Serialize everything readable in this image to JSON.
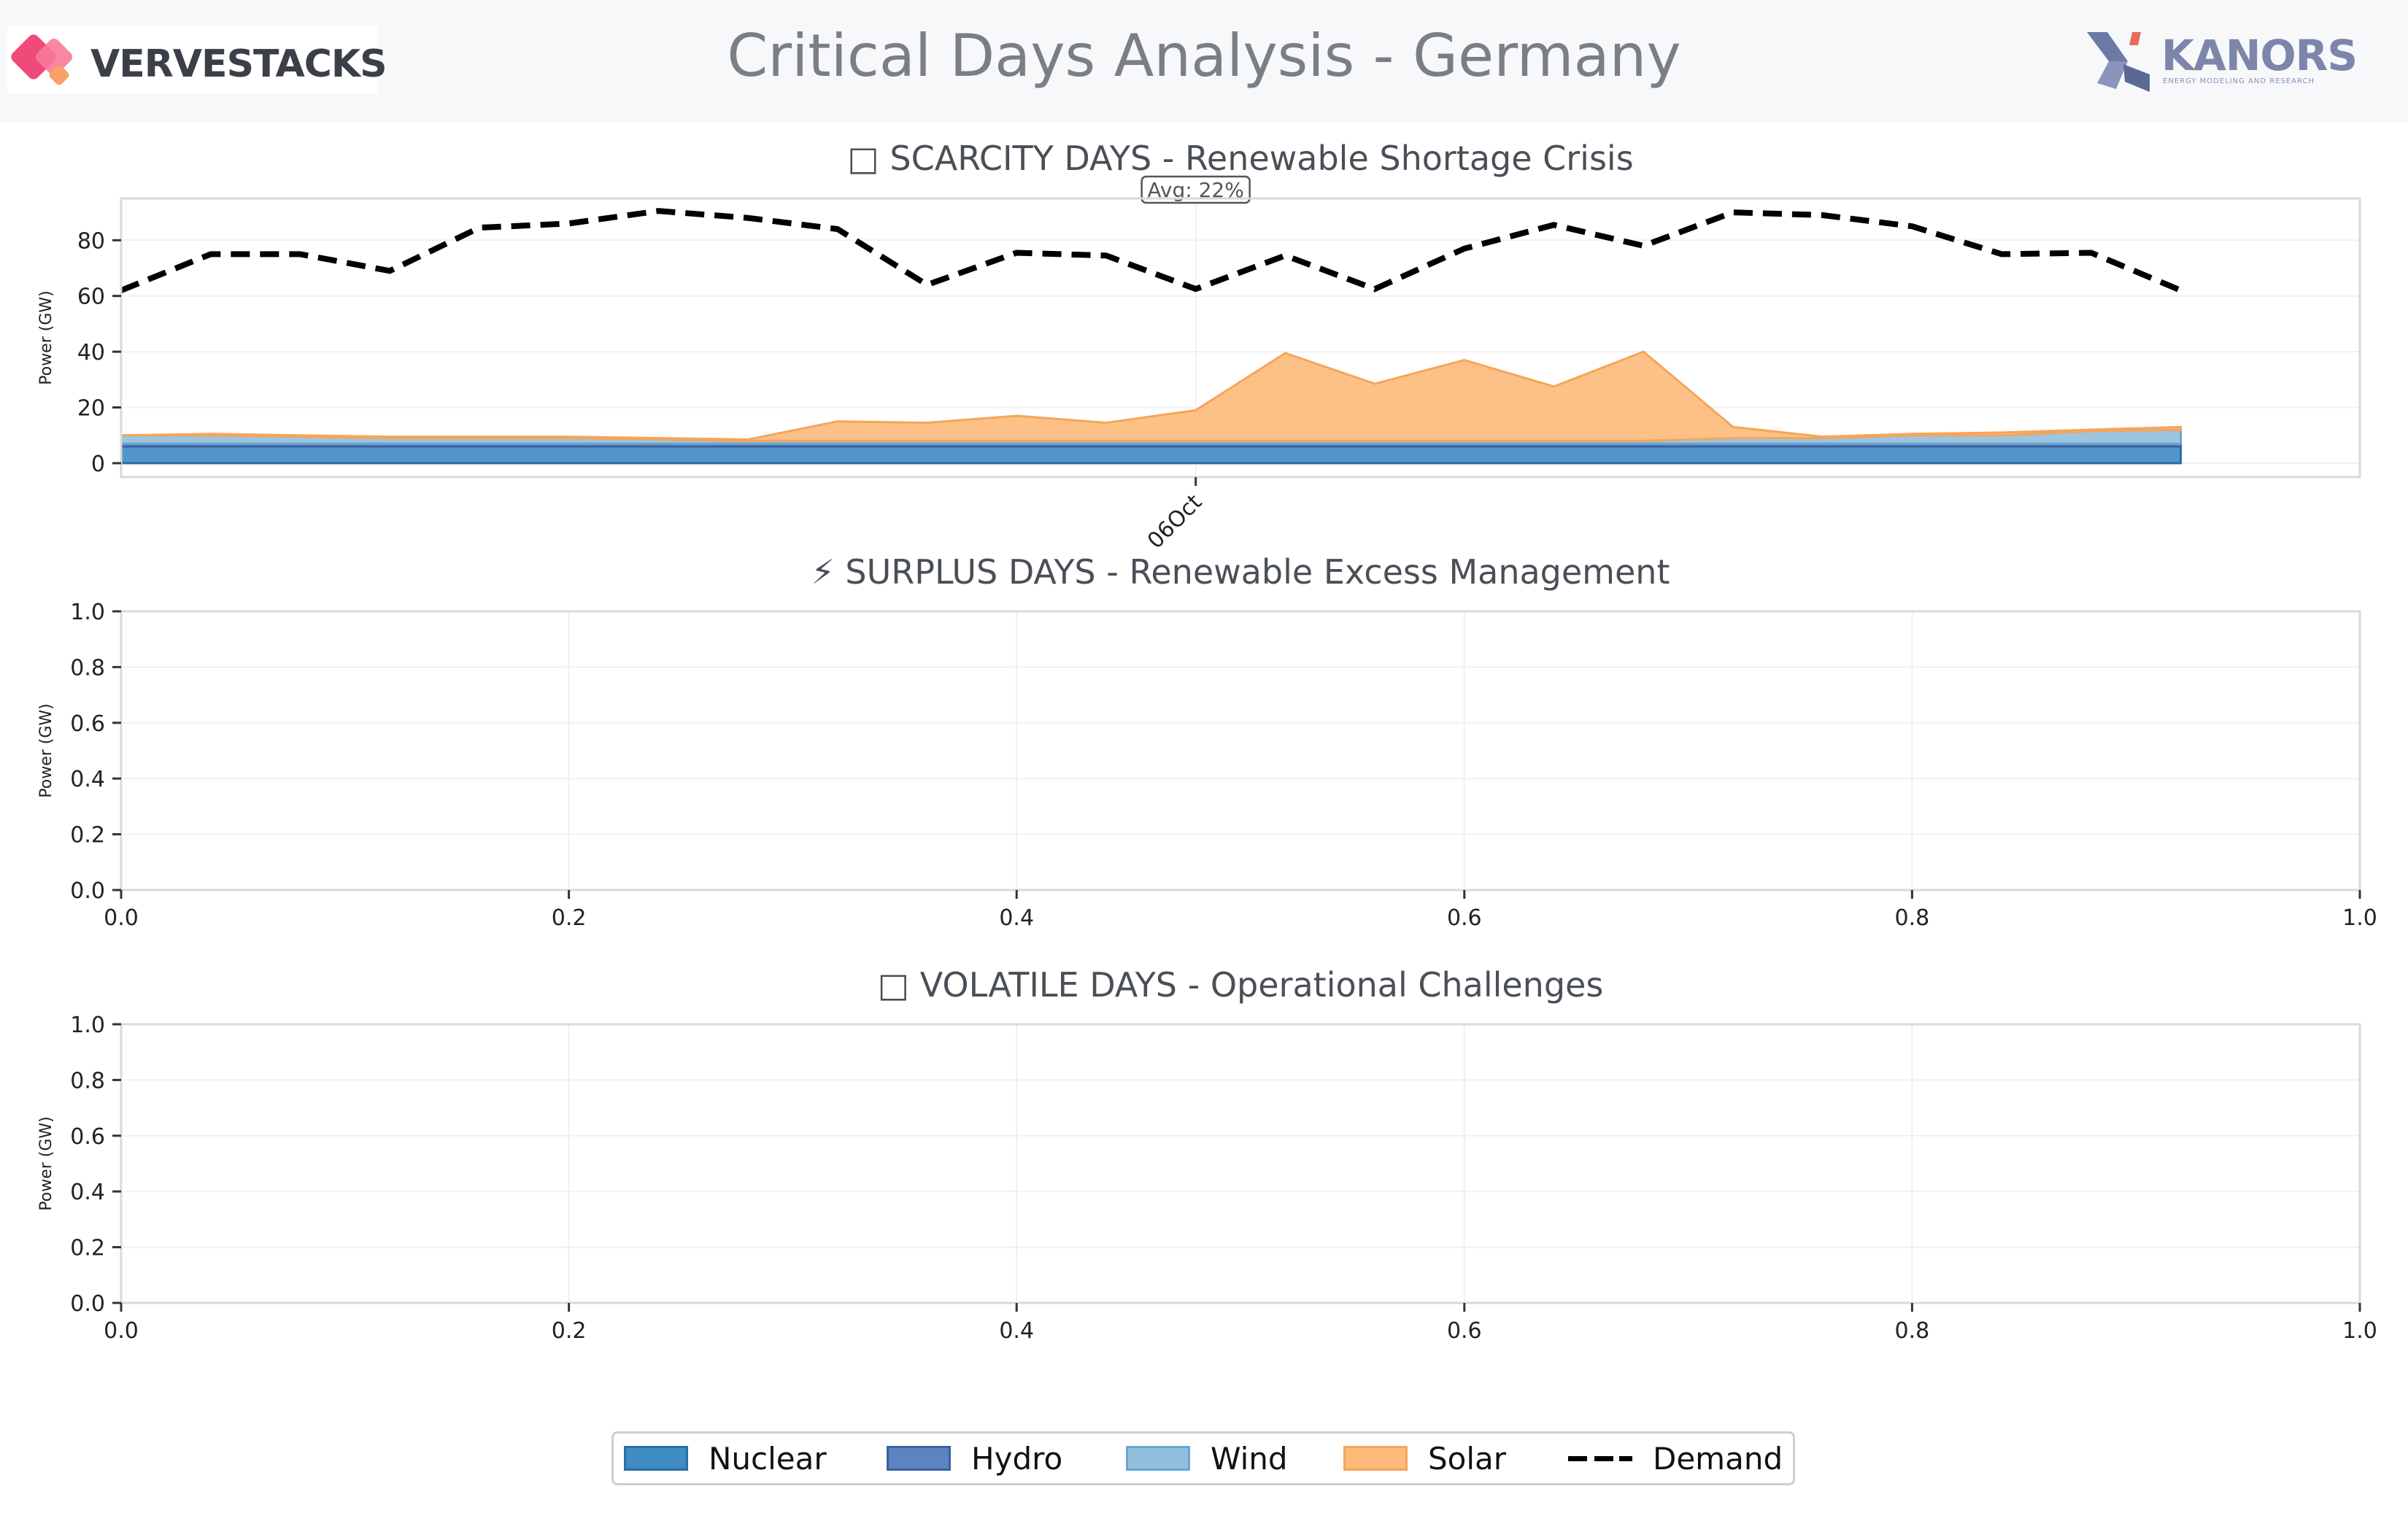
{
  "header": {
    "title": "Critical Days Analysis - Germany",
    "left_logo_text": "VERVESTACKS",
    "right_logo_text": "KANORS",
    "right_logo_subtitle": "ENERGY MODELING AND RESEARCH"
  },
  "colors": {
    "nuclear": "#1f77b4",
    "hydro": "#2c5aa0",
    "wind": "#6baed6",
    "solar": "#fd8d3c",
    "demand": "#000000",
    "grid": "#eeeeee",
    "axis": "#cccccc"
  },
  "legend": [
    {
      "name": "Nuclear",
      "kind": "area",
      "color": "#3f8bc4",
      "edge": "#2a6ea6"
    },
    {
      "name": "Hydro",
      "kind": "area",
      "color": "#5b84c0",
      "edge": "#3a62a0"
    },
    {
      "name": "Wind",
      "kind": "area",
      "color": "#92bfdd",
      "edge": "#6aa6cf"
    },
    {
      "name": "Solar",
      "kind": "area",
      "color": "#fdba7a",
      "edge": "#f5a55a"
    },
    {
      "name": "Demand",
      "kind": "dashed-line",
      "color": "#000000"
    }
  ],
  "chart_data": [
    {
      "type": "area",
      "title": "□ SCARCITY DAYS - Renewable Shortage Crisis",
      "ylabel": "Power (GW)",
      "ylim": [
        -5,
        95
      ],
      "yticks": [
        0,
        20,
        40,
        60,
        80
      ],
      "xticks": [
        {
          "x": 12,
          "label": "06Oct"
        }
      ],
      "xlim": [
        0,
        25
      ],
      "x": [
        0,
        1,
        2,
        3,
        4,
        5,
        6,
        7,
        8,
        9,
        10,
        11,
        12,
        13,
        14,
        15,
        16,
        17,
        18,
        19,
        20,
        21,
        22,
        23
      ],
      "annotation": "Avg: 22%",
      "series": [
        {
          "name": "Nuclear",
          "values": [
            6,
            6,
            6,
            6,
            6,
            6,
            6,
            6,
            6,
            6,
            6,
            6,
            6,
            6,
            6,
            6,
            6,
            6,
            6,
            6,
            6,
            6,
            6,
            6
          ]
        },
        {
          "name": "Hydro",
          "values": [
            1,
            1,
            1,
            1,
            1,
            1,
            1,
            1,
            1,
            1,
            1,
            1,
            1,
            1,
            1,
            1,
            1,
            1,
            1,
            1,
            1,
            1,
            1,
            1
          ]
        },
        {
          "name": "Wind",
          "values": [
            3,
            3,
            2.5,
            2,
            2,
            2,
            1.5,
            1,
            1,
            1,
            1,
            1,
            1,
            1,
            1,
            1,
            1,
            1,
            2,
            2,
            3,
            3,
            4.5,
            5
          ]
        },
        {
          "name": "Solar",
          "values": [
            0,
            0.5,
            0.5,
            0.5,
            0.5,
            0.5,
            0.5,
            0.5,
            7,
            6.5,
            9,
            6.5,
            11,
            31.5,
            20.5,
            29,
            19.5,
            32,
            4,
            0.5,
            0.5,
            1,
            0.5,
            1
          ]
        },
        {
          "name": "Demand",
          "values": [
            62,
            75,
            75,
            69,
            84.5,
            86,
            90.5,
            88,
            84,
            64,
            75.5,
            74.5,
            62.5,
            74.5,
            62.5,
            77,
            85.5,
            78,
            90,
            89,
            85,
            75,
            75.5,
            62
          ]
        }
      ]
    },
    {
      "type": "area",
      "title": "⚡ SURPLUS DAYS - Renewable Excess Management",
      "ylabel": "Power (GW)",
      "ylim": [
        0,
        1
      ],
      "xlim": [
        0,
        1
      ],
      "yticks": [
        "0.0",
        "0.2",
        "0.4",
        "0.6",
        "0.8",
        "1.0"
      ],
      "xticks": [
        "0.0",
        "0.2",
        "0.4",
        "0.6",
        "0.8",
        "1.0"
      ],
      "series": []
    },
    {
      "type": "area",
      "title": "□ VOLATILE DAYS - Operational Challenges",
      "ylabel": "Power (GW)",
      "ylim": [
        0,
        1
      ],
      "xlim": [
        0,
        1
      ],
      "yticks": [
        "0.0",
        "0.2",
        "0.4",
        "0.6",
        "0.8",
        "1.0"
      ],
      "xticks": [
        "0.0",
        "0.2",
        "0.4",
        "0.6",
        "0.8",
        "1.0"
      ],
      "series": []
    }
  ]
}
